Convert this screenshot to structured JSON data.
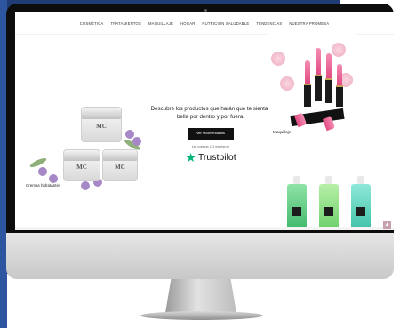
{
  "nav": {
    "items": [
      {
        "label": "COSMÉTICA"
      },
      {
        "label": "TRATAMIENTOS"
      },
      {
        "label": "MAQUILLAJE"
      },
      {
        "label": "HOGAR"
      },
      {
        "label": "NUTRICIÓN SALUDABLE"
      },
      {
        "label": "TENDENCIAS"
      },
      {
        "label": "NUESTRA PROMESA"
      }
    ]
  },
  "hero": {
    "headline": "Descubre los productos que harán que te sientas bella por dentro y por fuera.",
    "cta_label": "Ver recomendados",
    "reviews_text": "Lee nuestras 113 reseñas en",
    "trustpilot_label": "Trustpilot"
  },
  "tiles": {
    "left_caption": "Cremas hidratantes",
    "jar_logo": "MC",
    "right_caption": "Maquillaje"
  },
  "icons": {
    "apple": "",
    "trustpilot_star": "★",
    "scroll_top": "▲"
  },
  "colors": {
    "trustpilot_green": "#00b67a",
    "cta_background": "#111111",
    "background_panel": "#1f3d74"
  }
}
